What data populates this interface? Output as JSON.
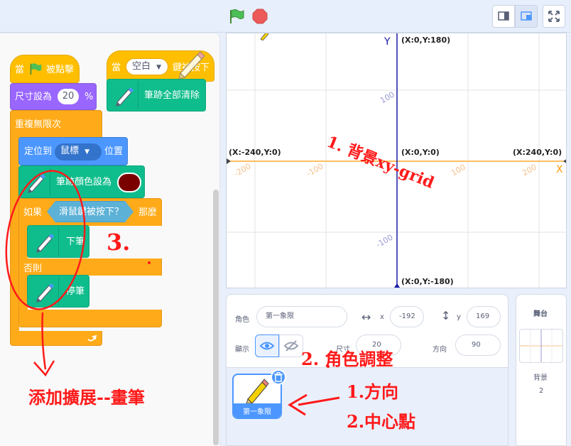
{
  "topbar": {
    "green_flag": "green-flag-icon",
    "stop": "stop-icon",
    "layout_small": "small-stage-icon",
    "layout_large": "large-stage-icon",
    "fullscreen": "fullscreen-icon"
  },
  "colors": {
    "events": "#ffbf00",
    "looks": "#9966ff",
    "control": "#ffab19",
    "motion": "#4c97ff",
    "pen": "#0fbd8c",
    "sensing": "#5cb1d6",
    "pen_color_value": "#7a0000",
    "axis": "#1a1aa6",
    "x_axis": "#ff9900",
    "annotation": "#ff1a1a"
  },
  "script": {
    "when_flag": {
      "prefix": "當",
      "suffix": "被點擊"
    },
    "set_size": {
      "label": "尺寸設為",
      "value": "20",
      "unit": "%"
    },
    "forever": {
      "label": "重複無限次"
    },
    "go_to": {
      "label": "定位到",
      "target": "鼠標",
      "suffix": "位置"
    },
    "set_pen_color": {
      "label": "筆跡顏色設為"
    },
    "if_else": {
      "if_label": "如果",
      "condition": "滑鼠鍵被按下？",
      "then_label": "那麼",
      "else_label": "否則"
    },
    "pen_down": {
      "label": "下筆"
    },
    "pen_up": {
      "label": "停筆"
    },
    "when_key": {
      "prefix": "當",
      "key": "空白",
      "suffix": "鍵被按下"
    },
    "erase_all": {
      "label": "筆跡全部清除"
    }
  },
  "stage": {
    "y_axis_label": "Y",
    "x_axis_label": "X",
    "top": "(X:0,Y:180)",
    "bottom": "(X:0,Y:-180)",
    "left": "(X:-240,Y:0)",
    "right": "(X:240,Y:0)",
    "center": "(X:0,Y:0)",
    "tick_y_pos": "100",
    "tick_y_neg": "-100",
    "tick_x_neg2": "-200",
    "tick_x_neg1": "-100",
    "tick_x_pos1": "100",
    "tick_x_pos2": "200"
  },
  "sprite_info": {
    "sprite_label": "角色",
    "sprite_name": "第一象限",
    "x_label": "x",
    "x_value": "-192",
    "y_label": "y",
    "y_value": "169",
    "show_label": "顯示",
    "size_label": "尺寸",
    "size_value": "20",
    "direction_label": "方向",
    "direction_value": "90"
  },
  "sprite_list": {
    "sprite_name": "第一象限"
  },
  "stage_panel": {
    "title": "舞台",
    "backdrop_label": "背景",
    "backdrop_count": "2"
  },
  "annotations": {
    "grid": "1. 背景xy-grid",
    "n3": "3.",
    "extension": "添加擴展--畫筆",
    "sprite_adjust": "2. 角色調整",
    "direction": "1.方向",
    "center": "2.中心點"
  }
}
